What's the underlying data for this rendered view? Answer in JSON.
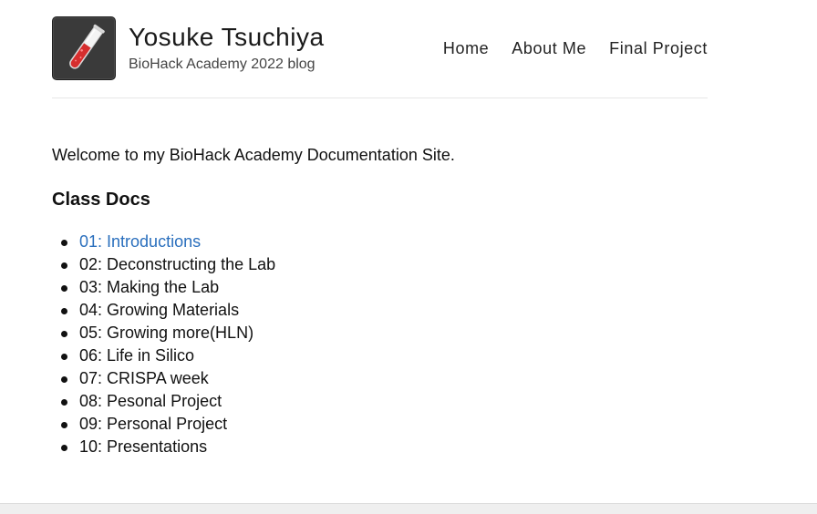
{
  "header": {
    "title": "Yosuke Tsuchiya",
    "subtitle": "BioHack Academy 2022 blog",
    "logo_icon": "test-tube-icon",
    "nav": [
      {
        "label": "Home"
      },
      {
        "label": "About Me"
      },
      {
        "label": "Final Project"
      }
    ]
  },
  "main": {
    "intro": "Welcome to my BioHack Academy Documentation Site.",
    "section_title": "Class Docs",
    "docs": [
      {
        "label": "01: Introductions",
        "link": true
      },
      {
        "label": "02: Deconstructing the Lab",
        "link": false
      },
      {
        "label": "03: Making the Lab",
        "link": false
      },
      {
        "label": "04: Growing Materials",
        "link": false
      },
      {
        "label": "05: Growing more(HLN)",
        "link": false
      },
      {
        "label": "06: Life in Silico",
        "link": false
      },
      {
        "label": "07: CRISPA week",
        "link": false
      },
      {
        "label": "08: Pesonal Project",
        "link": false
      },
      {
        "label": "09: Personal Project",
        "link": false
      },
      {
        "label": "10: Presentations",
        "link": false
      }
    ]
  },
  "colors": {
    "link": "#2a6fbd",
    "logo_bg": "#3a3a3a",
    "liquid": "#d62e2e"
  }
}
